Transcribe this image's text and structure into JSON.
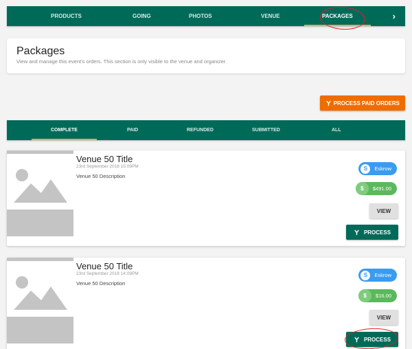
{
  "topnav": {
    "items": [
      {
        "label": "PRODUCTS"
      },
      {
        "label": "GOING"
      },
      {
        "label": "PHOTOS"
      },
      {
        "label": "VENUE"
      },
      {
        "label": "PACKAGES",
        "active": true
      }
    ],
    "chevron": "›"
  },
  "header": {
    "title": "Packages",
    "subtitle": "View and manage this event's orders. This section is only visible to the venue and organizer."
  },
  "actions": {
    "process_paid_label": "PROCESS PAID ORDERS"
  },
  "subnav": {
    "tabs": [
      {
        "label": "COMPLETE",
        "active": true
      },
      {
        "label": "PAID"
      },
      {
        "label": "REFUNDED"
      },
      {
        "label": "SUBMITTED"
      },
      {
        "label": "ALL"
      }
    ]
  },
  "orders": [
    {
      "title": "Venue 50 Title",
      "date": "23rd September 2018 15:09PM",
      "description": "Venue 50 Description",
      "payment_chip": "Eskrow",
      "amount": "$491.00",
      "view_label": "VIEW",
      "process_label": "PROCESS"
    },
    {
      "title": "Venue 50 Title",
      "date": "23rd September 2018 14:09PM",
      "description": "Venue 50 Description",
      "payment_chip": "Eskrow",
      "amount": "$16.00",
      "view_label": "VIEW",
      "process_label": "PROCESS"
    }
  ],
  "colors": {
    "primary": "#006a59",
    "accent": "#ef6c00",
    "tab_underline": "#f0a35a",
    "chip_blue": "#3b9bf0",
    "chip_green": "#5cb85c",
    "annotation_red": "#e02020"
  },
  "icons": {
    "escrow": "S",
    "dollar": "$"
  }
}
